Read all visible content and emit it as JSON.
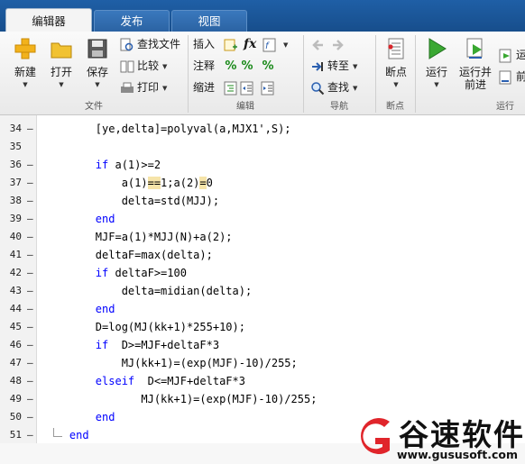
{
  "tabs": [
    "编辑器",
    "发布",
    "视图"
  ],
  "active_tab": "编辑器",
  "ribbon": {
    "file": {
      "new_label": "新建",
      "open_label": "打开",
      "save_label": "保存",
      "find_files_label": "查找文件",
      "compare_label": "比较",
      "print_label": "打印",
      "group_label": "文件"
    },
    "edit": {
      "insert_label": "插入",
      "comment_label": "注释",
      "indent_label": "缩进",
      "fx_label": "fx",
      "group_label": "编辑"
    },
    "navigate": {
      "goto_label": "转至",
      "find_label": "查找",
      "group_label": "导航"
    },
    "breakpoints": {
      "breakpoint_label": "断点",
      "group_label": "断点"
    },
    "run": {
      "run_label": "运行",
      "run_advance_label": "运行并\n前进",
      "run_section_partial": "运",
      "advance_partial": "前",
      "group_label": "运行"
    }
  },
  "code_lines": [
    {
      "num": "34",
      "marker": "–",
      "text": "        [ye,delta]=polyval(a,MJX1',S);"
    },
    {
      "num": "35",
      "marker": "",
      "text": ""
    },
    {
      "num": "36",
      "marker": "–",
      "text": "        if a(1)>=2"
    },
    {
      "num": "37",
      "marker": "–",
      "text": "            a(1)==1;a(2)=0"
    },
    {
      "num": "38",
      "marker": "–",
      "text": "            delta=std(MJJ);"
    },
    {
      "num": "39",
      "marker": "–",
      "text": "        end"
    },
    {
      "num": "40",
      "marker": "–",
      "text": "        MJF=a(1)*MJJ(N)+a(2);"
    },
    {
      "num": "41",
      "marker": "–",
      "text": "        deltaF=max(delta);"
    },
    {
      "num": "42",
      "marker": "–",
      "text": "        if deltaF>=100"
    },
    {
      "num": "43",
      "marker": "–",
      "text": "            delta=midian(delta);"
    },
    {
      "num": "44",
      "marker": "–",
      "text": "        end"
    },
    {
      "num": "45",
      "marker": "–",
      "text": "        D=log(MJ(kk+1)*255+10);"
    },
    {
      "num": "46",
      "marker": "–",
      "text": "        if  D>=MJF+deltaF*3"
    },
    {
      "num": "47",
      "marker": "–",
      "text": "            MJ(kk+1)=(exp(MJF)-10)/255;"
    },
    {
      "num": "48",
      "marker": "–",
      "text": "        elseif  D<=MJF+deltaF*3"
    },
    {
      "num": "49",
      "marker": "–",
      "text": "               MJ(kk+1)=(exp(MJF)-10)/255;"
    },
    {
      "num": "50",
      "marker": "–",
      "text": "        end"
    },
    {
      "num": "51",
      "marker": "–",
      "text": "    end"
    }
  ],
  "watermark": {
    "title": "谷速软件",
    "url": "www.gususoft.com"
  },
  "colors": {
    "tabbar": "#1f5fa6",
    "keyword": "#0000ff",
    "match_highlight": "#f6e4a9",
    "watermark_red": "#e0252b"
  }
}
